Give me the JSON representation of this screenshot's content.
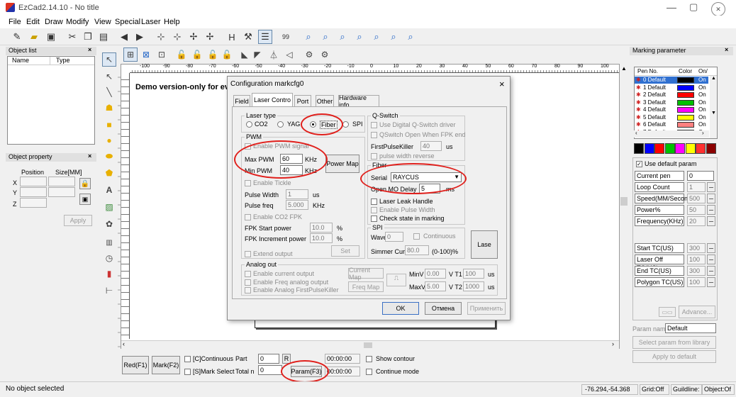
{
  "window": {
    "title": "EzCad2.14.10 - No title"
  },
  "menu": [
    "File",
    "Edit",
    "Draw",
    "Modify",
    "View",
    "Special",
    "Laser",
    "Help"
  ],
  "object_list": {
    "title": "Object list",
    "close": "×",
    "col_name": "Name",
    "col_type": "Type"
  },
  "object_property": {
    "title": "Object property",
    "close": "×",
    "position": "Position",
    "size": "Size[MM]",
    "x": "X",
    "y": "Y",
    "z": "Z",
    "apply": "Apply"
  },
  "canvas": {
    "demo_text": "Demo version-only for eval",
    "ruler_labels": [
      "-100",
      "-90",
      "-80",
      "-70",
      "-60",
      "-50",
      "-40",
      "-30",
      "-20",
      "-10",
      "0",
      "10",
      "20",
      "30",
      "40",
      "50",
      "60",
      "70",
      "80",
      "90",
      "100"
    ]
  },
  "dialog": {
    "title": "Configuration markcfg0",
    "close": "×",
    "tabs": [
      "Field",
      "Laser Contro",
      "Port",
      "Other",
      "Hardware info"
    ],
    "laser_type": {
      "title": "Laser type",
      "options": [
        "CO2",
        "YAG",
        "Fiber",
        "SPI"
      ],
      "selected": "Fiber"
    },
    "pwm": {
      "title": "PWM",
      "enable_pwm": "Enable PWM signal",
      "max_label": "Max PWM",
      "max_value": "60",
      "min_label": "Min PWM",
      "min_value": "40",
      "unit": "KHz",
      "power_map": "Power Map",
      "enable_tickle": "Enable Tickle",
      "pulse_width": "Pulse Width",
      "pulse_width_value": "1",
      "pulse_width_unit": "us",
      "pulse_freq": "Pulse freq",
      "pulse_freq_value": "5.000",
      "pulse_freq_unit": "KHz",
      "enable_co2_fpk": "Enable CO2 FPK",
      "fpk_start": "FPK Start power",
      "fpk_start_value": "10.0",
      "fpk_inc": "FPK Increment power",
      "fpk_inc_value": "10.0",
      "pct": "%",
      "set": "Set",
      "extend_output": "Extend output"
    },
    "qswitch": {
      "title": "Q-Switch",
      "use_digital": "Use Digital Q-Switch driver",
      "open_when_fpk": "QSwitch Open When FPK end",
      "first_pulse": "FirstPulseKiller",
      "first_pulse_value": "40",
      "first_pulse_unit": "us",
      "pulse_width_reverse": "pulse width reverse"
    },
    "fiber": {
      "title": "Fiber",
      "serial_label": "Serial",
      "serial_value": "RAYCUS",
      "open_mo_label": "Open MO Delay",
      "open_mo_value": "5",
      "open_mo_unit": "ms",
      "laser_leak": "Laser Leak Handle",
      "enable_pulse_width": "Enable Pulse Width",
      "check_state": "Check state in marking"
    },
    "spi": {
      "title": "SPI",
      "wave": "Wave",
      "wave_value": "0",
      "continuous": "Continuous",
      "simmer": "Simmer Cur",
      "simmer_value": "80.0",
      "simmer_range": "(0-100)%",
      "lase": "Lase"
    },
    "analog": {
      "title": "Analog out",
      "enable_current": "Enable current output",
      "enable_freq": "Enable Freq analog output",
      "enable_analog_fpk": "Enable Analog FirstPulseKiller",
      "current_map": "Current Map",
      "freq_map": "Freq Map",
      "minv": "MinV",
      "minv_value": "0.00",
      "maxv": "MaxV",
      "maxv_value": "5.00",
      "t1": "V T1",
      "t1_value": "100",
      "t2": "V T2",
      "t2_value": "1000",
      "us": "us"
    },
    "ok": "OK",
    "cancel": "Отмена",
    "apply": "Применить"
  },
  "marking": {
    "title": "Marking parameter",
    "close": "×",
    "cols": [
      "Pen No.",
      "Color",
      "On/"
    ],
    "pens": [
      {
        "name": "0 Default",
        "color": "#000000",
        "on": "On"
      },
      {
        "name": "1 Default",
        "color": "#0000ff",
        "on": "On"
      },
      {
        "name": "2 Default",
        "color": "#ff0000",
        "on": "On"
      },
      {
        "name": "3 Default",
        "color": "#00c000",
        "on": "On"
      },
      {
        "name": "4 Default",
        "color": "#ff00ff",
        "on": "On"
      },
      {
        "name": "5 Default",
        "color": "#ffff00",
        "on": "On"
      },
      {
        "name": "6 Default",
        "color": "#ff8080",
        "on": "On"
      },
      {
        "name": "7 Default",
        "color": "#8080ff",
        "on": "On"
      }
    ],
    "palette": [
      "#000000",
      "#0000ff",
      "#ff0000",
      "#00c000",
      "#ff00ff",
      "#ffff00",
      "#ff3030",
      "#8b0000"
    ],
    "use_default": "Use default param",
    "current_pen": "Current pen",
    "current_pen_value": "0",
    "loop_count": "Loop Count",
    "loop_count_value": "1",
    "speed": "Speed(MM/Seconc",
    "speed_value": "500",
    "power": "Power%",
    "power_value": "50",
    "freq": "Frequency(KHz)",
    "freq_value": "20",
    "start_tc": "Start TC(US)",
    "start_tc_value": "300",
    "laser_off_tc": "Laser Off TC(US)",
    "laser_off_tc_value": "100",
    "end_tc": "End TC(US)",
    "end_tc_value": "300",
    "polygon_tc": "Polygon TC(US)",
    "polygon_tc_value": "100",
    "advance": "Advance...",
    "param_name_label": "Param name",
    "param_name_value": "Default",
    "select_lib": "Select param from library",
    "apply_default": "Apply to default"
  },
  "bottom": {
    "red": "Red(F1)",
    "mark": "Mark(F2)",
    "continuous": "[C]Continuous",
    "part": "Part",
    "part_value": "0",
    "r": "R",
    "mark_select": "[S]Mark Select",
    "total": "Total n",
    "total_value": "0",
    "param": "Param(F3)",
    "time1": "00:00:00",
    "time2": "00:00:00",
    "show_contour": "Show contour",
    "continue_mode": "Continue mode"
  },
  "statusbar": {
    "left": "No object selected",
    "coords": "-76.294,-54.368",
    "grid": "Grid:Off",
    "guideline": "Guildline:(",
    "object": "Object:Of"
  }
}
